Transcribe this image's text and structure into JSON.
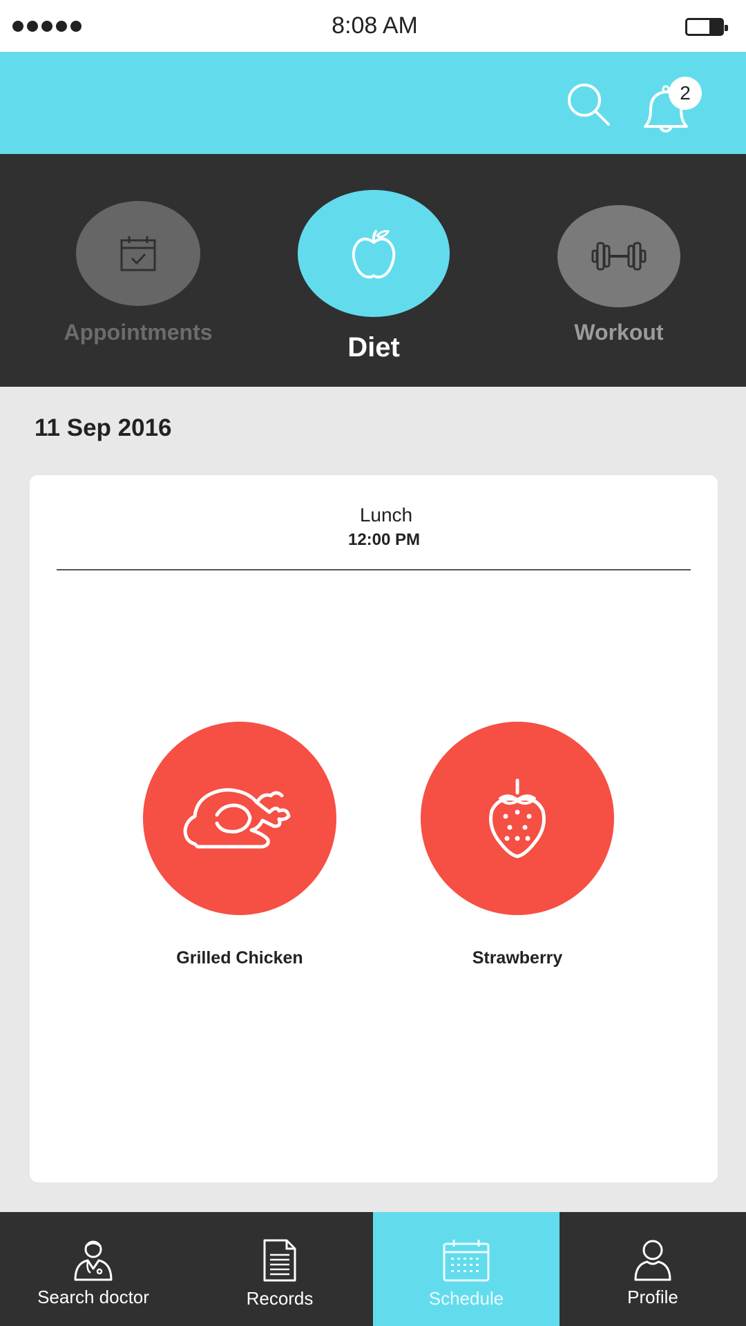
{
  "status_bar": {
    "time": "8:08 AM",
    "signal_bars": 5
  },
  "header": {
    "notification_count": "2"
  },
  "categories": [
    {
      "label": "Appointments",
      "icon": "calendar-check-icon",
      "active": false
    },
    {
      "label": "Diet",
      "icon": "apple-icon",
      "active": true
    },
    {
      "label": "Workout",
      "icon": "dumbbell-icon",
      "active": false
    }
  ],
  "main": {
    "date": "11 Sep 2016",
    "meal": {
      "name": "Lunch",
      "time": "12:00 PM",
      "foods": [
        {
          "label": "Grilled Chicken",
          "icon": "chicken-icon"
        },
        {
          "label": "Strawberry",
          "icon": "strawberry-icon"
        }
      ]
    }
  },
  "bottom_nav": [
    {
      "label": "Search doctor",
      "icon": "doctor-icon"
    },
    {
      "label": "Records",
      "icon": "document-icon"
    },
    {
      "label": "Schedule",
      "icon": "calendar-icon",
      "active": true
    },
    {
      "label": "Profile",
      "icon": "user-icon"
    }
  ],
  "colors": {
    "accent": "#62dcec",
    "dark": "#303031",
    "food": "#f64f44",
    "background": "#e8e8e8"
  }
}
